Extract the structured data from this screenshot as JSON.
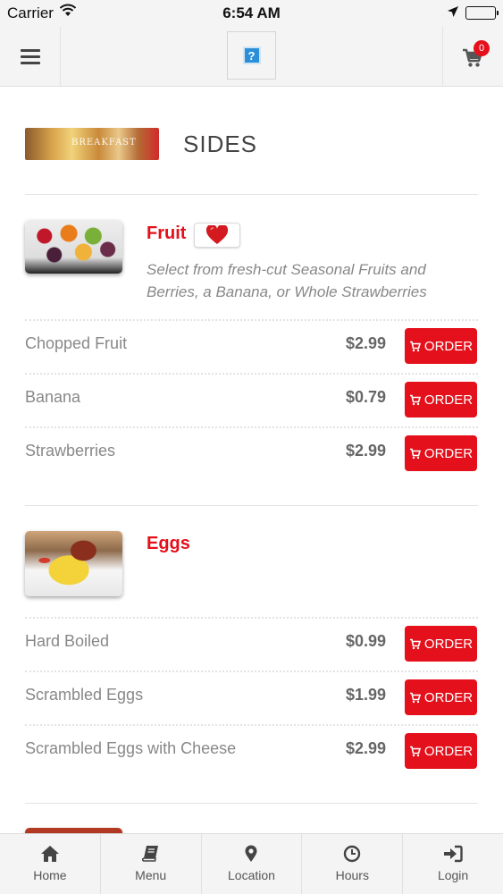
{
  "status_bar": {
    "carrier": "Carrier",
    "time": "6:54 AM"
  },
  "header": {
    "cart_count": "0"
  },
  "section": {
    "title": "SIDES",
    "image_caption": "BREAKFAST"
  },
  "groups": [
    {
      "name": "Fruit",
      "description": "Select from fresh-cut Seasonal Fruits and Berries, a Banana, or Whole Strawberries",
      "items": [
        {
          "name": "Chopped Fruit",
          "price": "$2.99",
          "order_label": "ORDER"
        },
        {
          "name": "Banana",
          "price": "$0.79",
          "order_label": "ORDER"
        },
        {
          "name": "Strawberries",
          "price": "$2.99",
          "order_label": "ORDER"
        }
      ]
    },
    {
      "name": "Eggs",
      "description": "",
      "items": [
        {
          "name": "Hard Boiled",
          "price": "$0.99",
          "order_label": "ORDER"
        },
        {
          "name": "Scrambled Eggs",
          "price": "$1.99",
          "order_label": "ORDER"
        },
        {
          "name": "Scrambled Eggs with Cheese",
          "price": "$2.99",
          "order_label": "ORDER"
        }
      ]
    }
  ],
  "bottom_nav": [
    {
      "label": "Home",
      "icon": "home-icon"
    },
    {
      "label": "Menu",
      "icon": "book-icon"
    },
    {
      "label": "Location",
      "icon": "map-pin-icon"
    },
    {
      "label": "Hours",
      "icon": "clock-icon"
    },
    {
      "label": "Login",
      "icon": "sign-in-icon"
    }
  ],
  "colors": {
    "accent": "#e4101b",
    "header_bg": "#f4f4f4"
  }
}
